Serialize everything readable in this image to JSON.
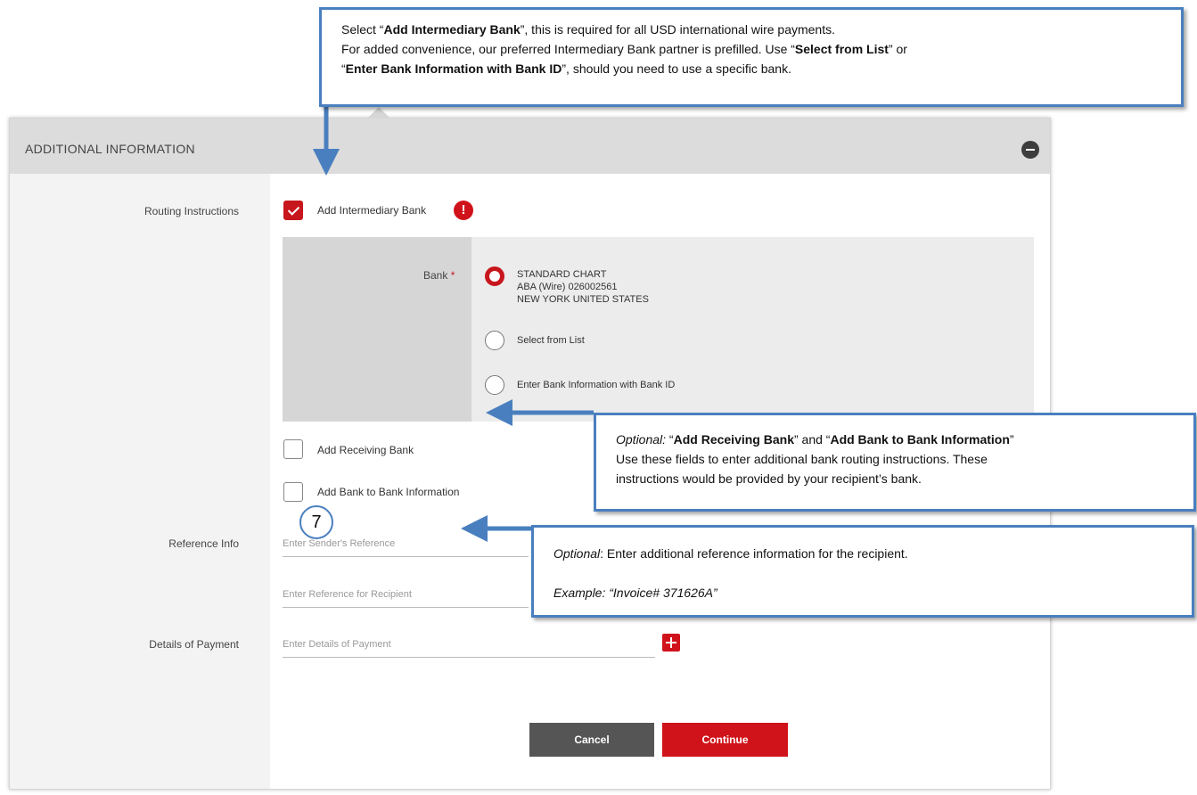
{
  "section": {
    "title": "ADDITIONAL INFORMATION"
  },
  "routing": {
    "label": "Routing Instructions",
    "add_intermediary_label": "Add Intermediary Bank",
    "intermediary_checked": true,
    "bank_label": "Bank",
    "required_marker": "*",
    "bank_options": [
      {
        "line1": "STANDARD CHART",
        "line2": "ABA (Wire) 026002561",
        "line3": "NEW YORK UNITED STATES",
        "selected": true
      },
      {
        "line1": "Select from List",
        "selected": false
      },
      {
        "line1": "Enter Bank Information with Bank ID",
        "selected": false
      }
    ],
    "add_receiving_label": "Add Receiving Bank",
    "add_b2b_label": "Add Bank to Bank Information"
  },
  "reference": {
    "label": "Reference Info",
    "sender_placeholder": "Enter Sender's Reference",
    "recipient_placeholder": "Enter Reference for Recipient"
  },
  "details": {
    "label": "Details of Payment",
    "placeholder": "Enter Details of Payment"
  },
  "actions": {
    "cancel": "Cancel",
    "continue": "Continue"
  },
  "callouts": {
    "top": {
      "p1_a": "Select “",
      "p1_b": "Add Intermediary Bank",
      "p1_c": "”, this is required for all USD international wire payments.",
      "p2_a": "For added convenience, our preferred Intermediary Bank partner is prefilled. Use “",
      "p2_b": "Select from List",
      "p2_c": "” or",
      "p3_a": "“",
      "p3_b": "Enter Bank Information with Bank ID",
      "p3_c": "”, should you need to use a specific bank."
    },
    "middle": {
      "optional": "Optional:",
      "a": " “",
      "b": "Add Receiving Bank",
      "c": "” and “",
      "d": "Add Bank to Bank Information",
      "e": "”",
      "line2": "Use these fields to enter additional bank routing instructions. These",
      "line3": "instructions would be provided by your recipient’s bank."
    },
    "bottom": {
      "optional": "Optional",
      "rest": ": Enter additional reference information for the recipient.",
      "example": "Example: “Invoice# 371626A”"
    },
    "step_number": "7"
  },
  "colors": {
    "accent": "#c8161d",
    "callout_border": "#4a7fbf",
    "cancel_bg": "#555555"
  }
}
